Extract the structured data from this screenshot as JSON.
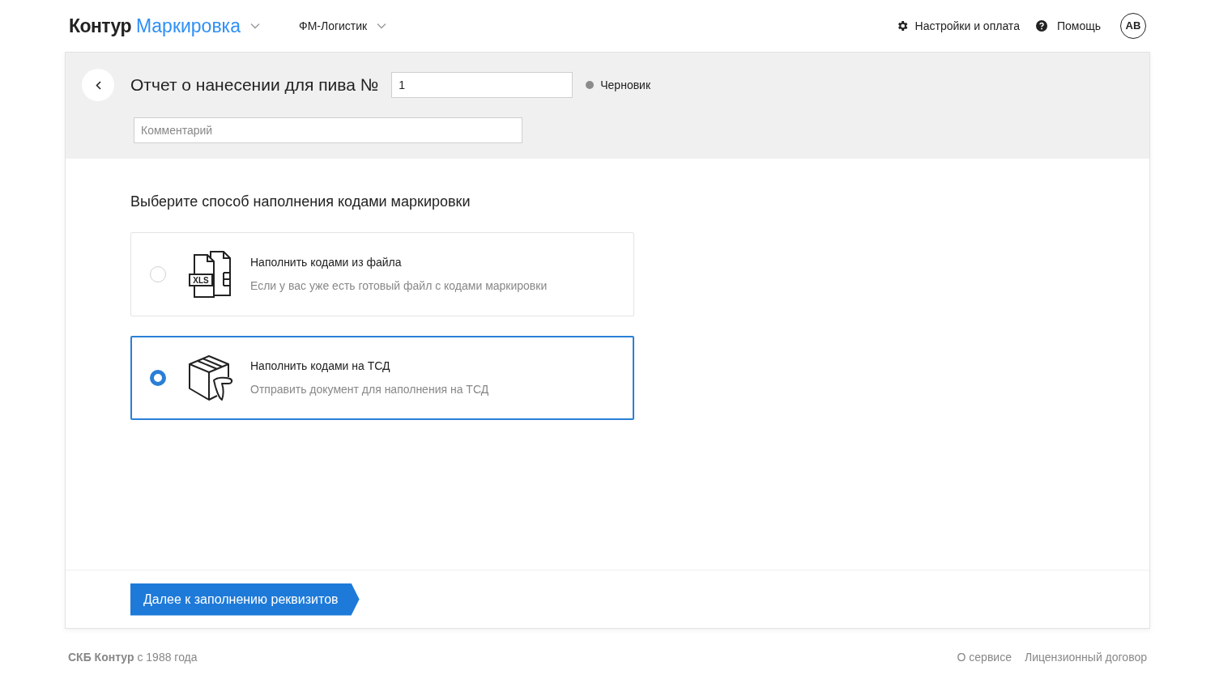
{
  "header": {
    "logo_brand": "Контур",
    "logo_product": "Маркировка",
    "organization": "ФМ-Логистик",
    "settings": "Настройки и оплата",
    "help": "Помощь",
    "avatar": "AB"
  },
  "document": {
    "title": "Отчет о нанесении для пива №",
    "number": "1",
    "status": "Черновик",
    "comment_placeholder": "Комментарий"
  },
  "section_title": "Выберите способ наполнения кодами маркировки",
  "options": [
    {
      "kind": "file",
      "icon_text": "XLS",
      "title": "Наполнить кодами из файла",
      "description": "Если у вас уже есть готовый файл с кодами маркировки",
      "selected": false
    },
    {
      "kind": "scanner",
      "title": "Наполнить кодами на ТСД",
      "description": "Отправить документ для наполнения на ТСД",
      "selected": true
    }
  ],
  "next_button": "Далее к заполнению реквизитов",
  "footer": {
    "copyright": "**СКБ Контур** с 1988 года",
    "links": [
      "О сервисе",
      "Лицензионный договор"
    ]
  }
}
